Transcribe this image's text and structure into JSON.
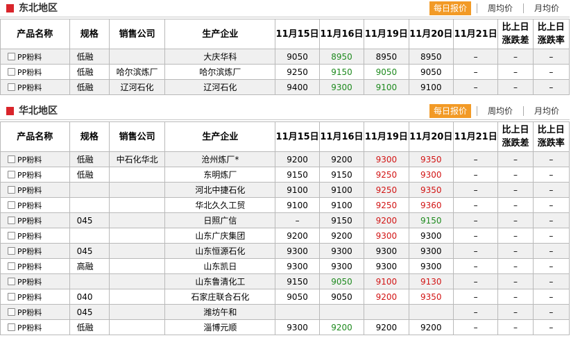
{
  "tabs": [
    "每日报价",
    "周均价",
    "月均价"
  ],
  "columns": [
    "产品名称",
    "规格",
    "销售公司",
    "生产企业",
    "11月15日",
    "11月16日",
    "11月19日",
    "11月20日",
    "11月21日",
    "比上日\n涨跌差",
    "比上日\n涨跌率"
  ],
  "sections": [
    {
      "title": "东北地区",
      "rows": [
        {
          "product": "PP粉料",
          "spec": "低融",
          "seller": "",
          "producer": "大庆华科",
          "v15": "9050",
          "v16": "8950",
          "c16": "green",
          "v19": "8950",
          "c19": "",
          "v20": "8950",
          "c20": "",
          "v21": "–",
          "diff": "–",
          "rate": "–"
        },
        {
          "product": "PP粉料",
          "spec": "低融",
          "seller": "哈尔滨炼厂",
          "producer": "哈尔滨炼厂",
          "v15": "9250",
          "v16": "9150",
          "c16": "green",
          "v19": "9050",
          "c19": "green",
          "v20": "9050",
          "c20": "",
          "v21": "–",
          "diff": "–",
          "rate": "–"
        },
        {
          "product": "PP粉料",
          "spec": "低融",
          "seller": "辽河石化",
          "producer": "辽河石化",
          "v15": "9400",
          "v16": "9300",
          "c16": "green",
          "v19": "9100",
          "c19": "green",
          "v20": "9100",
          "c20": "",
          "v21": "–",
          "diff": "–",
          "rate": "–"
        }
      ]
    },
    {
      "title": "华北地区",
      "rows": [
        {
          "product": "PP粉料",
          "spec": "低融",
          "seller": "中石化华北",
          "producer": "沧州炼厂*",
          "v15": "9200",
          "v16": "9200",
          "c16": "",
          "v19": "9300",
          "c19": "red",
          "v20": "9350",
          "c20": "red",
          "v21": "–",
          "diff": "–",
          "rate": "–"
        },
        {
          "product": "PP粉料",
          "spec": "低融",
          "seller": "",
          "producer": "东明炼厂",
          "v15": "9150",
          "v16": "9150",
          "c16": "",
          "v19": "9250",
          "c19": "red",
          "v20": "9300",
          "c20": "red",
          "v21": "–",
          "diff": "–",
          "rate": "–"
        },
        {
          "product": "PP粉料",
          "spec": "",
          "seller": "",
          "producer": "河北中捷石化",
          "v15": "9100",
          "v16": "9100",
          "c16": "",
          "v19": "9250",
          "c19": "red",
          "v20": "9350",
          "c20": "red",
          "v21": "–",
          "diff": "–",
          "rate": "–"
        },
        {
          "product": "PP粉料",
          "spec": "",
          "seller": "",
          "producer": "华北久久工贸",
          "v15": "9100",
          "v16": "9100",
          "c16": "",
          "v19": "9250",
          "c19": "red",
          "v20": "9360",
          "c20": "red",
          "v21": "–",
          "diff": "–",
          "rate": "–"
        },
        {
          "product": "PP粉料",
          "spec": "045",
          "seller": "",
          "producer": "日照广信",
          "v15": "–",
          "v16": "9150",
          "c16": "",
          "v19": "9200",
          "c19": "red",
          "v20": "9150",
          "c20": "green",
          "v21": "–",
          "diff": "–",
          "rate": "–"
        },
        {
          "product": "PP粉料",
          "spec": "",
          "seller": "",
          "producer": "山东广庆集团",
          "v15": "9200",
          "v16": "9200",
          "c16": "",
          "v19": "9300",
          "c19": "red",
          "v20": "9300",
          "c20": "",
          "v21": "–",
          "diff": "–",
          "rate": "–"
        },
        {
          "product": "PP粉料",
          "spec": "045",
          "seller": "",
          "producer": "山东恒源石化",
          "v15": "9300",
          "v16": "9300",
          "c16": "",
          "v19": "9300",
          "c19": "",
          "v20": "9300",
          "c20": "",
          "v21": "–",
          "diff": "–",
          "rate": "–"
        },
        {
          "product": "PP粉料",
          "spec": "高融",
          "seller": "",
          "producer": "山东凯日",
          "v15": "9300",
          "v16": "9300",
          "c16": "",
          "v19": "9300",
          "c19": "",
          "v20": "9300",
          "c20": "",
          "v21": "–",
          "diff": "–",
          "rate": "–"
        },
        {
          "product": "PP粉料",
          "spec": "",
          "seller": "",
          "producer": "山东鲁清化工",
          "v15": "9150",
          "v16": "9050",
          "c16": "green",
          "v19": "9100",
          "c19": "red",
          "v20": "9130",
          "c20": "red",
          "v21": "–",
          "diff": "–",
          "rate": "–"
        },
        {
          "product": "PP粉料",
          "spec": "040",
          "seller": "",
          "producer": "石家庄联合石化",
          "v15": "9050",
          "v16": "9050",
          "c16": "",
          "v19": "9200",
          "c19": "red",
          "v20": "9350",
          "c20": "red",
          "v21": "–",
          "diff": "–",
          "rate": "–"
        },
        {
          "product": "PP粉料",
          "spec": "045",
          "seller": "",
          "producer": "潍坊午和",
          "v15": "",
          "v16": "",
          "c16": "",
          "v19": "",
          "c19": "",
          "v20": "",
          "c20": "",
          "v21": "–",
          "diff": "–",
          "rate": "–"
        },
        {
          "product": "PP粉料",
          "spec": "低融",
          "seller": "",
          "producer": "淄博元顺",
          "v15": "9300",
          "v16": "9200",
          "c16": "green",
          "v19": "9200",
          "c19": "",
          "v20": "9200",
          "c20": "",
          "v21": "–",
          "diff": "–",
          "rate": "–"
        }
      ]
    }
  ]
}
